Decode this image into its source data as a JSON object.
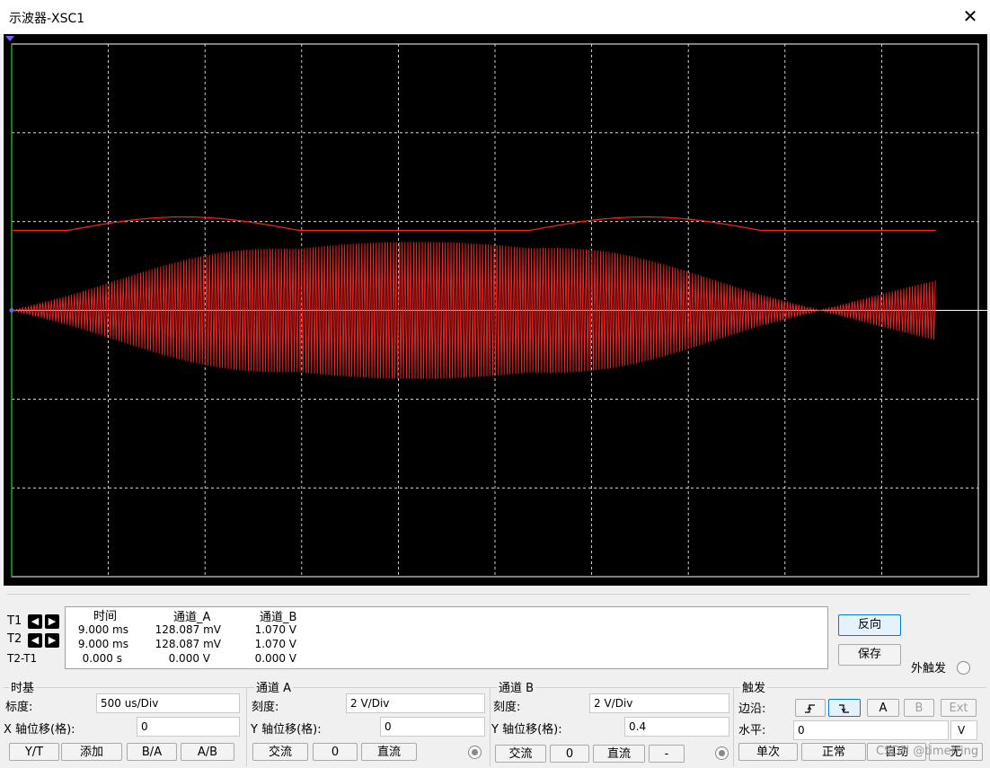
{
  "window": {
    "title": "示波器-XSC1",
    "close_glyph": "✕"
  },
  "colors": {
    "trace_a": "#ff2020",
    "grid": "#ffffff",
    "screen_bg": "#000000",
    "axis_marker": "#7a5cff",
    "left_edge": "#2aa52a"
  },
  "readout": {
    "headers": {
      "time": "时间",
      "channel_a": "通道_A",
      "channel_b": "通道_B"
    },
    "rows": [
      {
        "label": "T1",
        "time": "9.000 ms",
        "a": "128.087 mV",
        "b": "1.070 V"
      },
      {
        "label": "T2",
        "time": "9.000 ms",
        "a": "128.087 mV",
        "b": "1.070 V"
      },
      {
        "label": "T2-T1",
        "time": "0.000 s",
        "a": "0.000 V",
        "b": "0.000 V"
      }
    ]
  },
  "side_buttons": {
    "reverse": "反向",
    "save": "保存",
    "ext_trigger": "外触发"
  },
  "timebase": {
    "title": "时基",
    "scale_label": "标度:",
    "scale_value": "500 us/Div",
    "xpos_label": "X 轴位移(格):",
    "xpos_value": "0",
    "buttons": [
      "Y/T",
      "添加",
      "B/A",
      "A/B"
    ]
  },
  "channel_a": {
    "title": "通道 A",
    "scale_label": "刻度:",
    "scale_value": "2  V/Div",
    "ypos_label": "Y 轴位移(格):",
    "ypos_value": "0",
    "coupling": [
      "交流",
      "0",
      "直流"
    ]
  },
  "channel_b": {
    "title": "通道 B",
    "scale_label": "刻度:",
    "scale_value": "2  V/Div",
    "ypos_label": "Y 轴位移(格):",
    "ypos_value": "0.4",
    "coupling": [
      "交流",
      "0",
      "直流",
      "-"
    ]
  },
  "trigger": {
    "title": "触发",
    "edge_label": "边沿:",
    "edge_buttons": [
      "A",
      "B",
      "Ext"
    ],
    "level_label": "水平:",
    "level_value": "0",
    "level_unit": "V",
    "mode_buttons": [
      "单次",
      "正常",
      "自动",
      "无"
    ]
  },
  "watermark": "CSDN @timerring"
}
